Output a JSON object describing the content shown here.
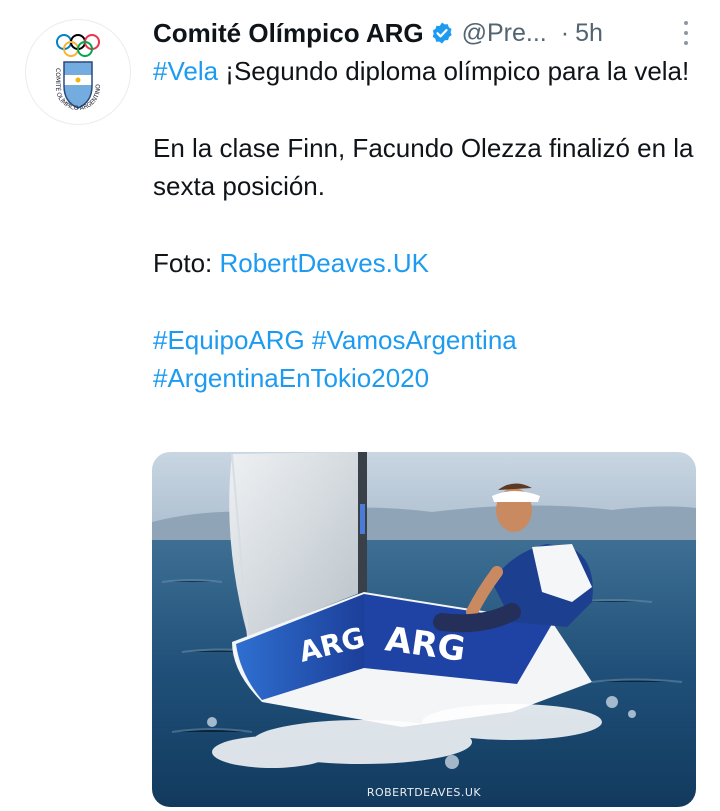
{
  "account": {
    "display_name": "Comité Olímpico ARG",
    "handle": "@Pre...",
    "separator": "·",
    "time": "5h",
    "avatar_text": "COMITÉ OLÍMPICO ARGENTINO"
  },
  "tweet": {
    "line1_hashtag": "#Vela",
    "line1_text": " ¡Segundo diploma olímpico para la vela!",
    "line2": "En la clase Finn, Facundo Olezza finalizó en la sexta posición.",
    "photo_prefix": "Foto: ",
    "photo_link": "RobertDeaves.UK",
    "hashtag_1": "#EquipoARG",
    "hashtag_2": "#VamosArgentina",
    "hashtag_3": "#ArgentinaEnTokio2020"
  },
  "media": {
    "boat_label_bow": "ARG",
    "boat_label_side": "ARG",
    "watermark": "ROBERTDEAVES.UK"
  },
  "colors": {
    "link": "#1d9bf0",
    "verified": "#1d9bf0",
    "text": "#0f1419",
    "secondary": "#536471"
  }
}
